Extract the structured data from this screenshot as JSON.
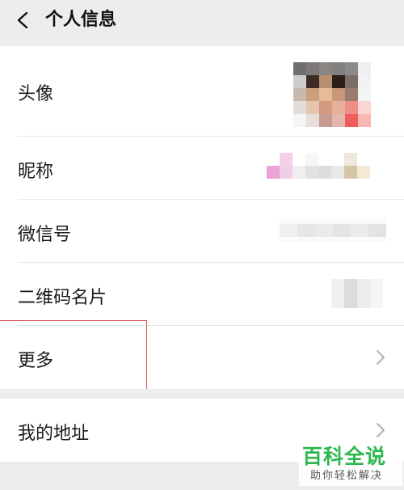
{
  "header": {
    "title": "个人信息",
    "back_icon": "chevron-left-icon"
  },
  "profile": {
    "avatar_label": "头像",
    "nickname_label": "昵称",
    "wechat_id_label": "微信号",
    "qr_code_label": "二维码名片",
    "more_label": "更多"
  },
  "address": {
    "label": "我的地址"
  },
  "watermark": {
    "main": "百科全说",
    "sub": "助你轻松解决"
  },
  "colors": {
    "highlight_border": "#e24a4a",
    "watermark_green": "#2db84d",
    "page_bg": "#ededed"
  }
}
